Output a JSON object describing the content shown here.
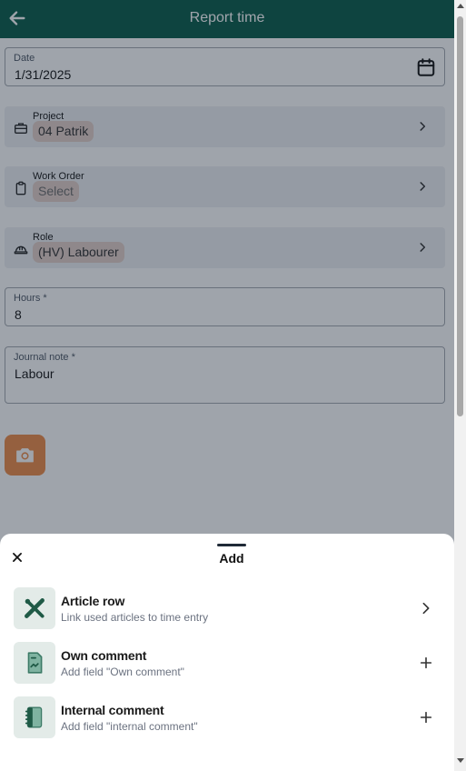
{
  "header": {
    "title": "Report time",
    "back_icon": "arrow-left-icon"
  },
  "form": {
    "date": {
      "label": "Date",
      "value": "1/31/2025",
      "icon": "calendar-icon"
    },
    "project": {
      "label": "Project",
      "value": "04 Patrik",
      "icon": "briefcase-icon"
    },
    "work_order": {
      "label": "Work Order",
      "value": "Select",
      "icon": "clipboard-icon"
    },
    "role": {
      "label": "Role",
      "value": "(HV) Labourer",
      "icon": "hard-hat-icon"
    },
    "hours": {
      "label": "Hours *",
      "value": "8"
    },
    "journal_note": {
      "label": "Journal note *",
      "value": "Labour"
    },
    "camera_icon": "camera-icon"
  },
  "sheet": {
    "title": "Add",
    "close_icon": "close-icon",
    "options": [
      {
        "title": "Article row",
        "subtitle": "Link used articles to time entry",
        "icon": "tools-icon",
        "action_icon": "chevron-right-icon"
      },
      {
        "title": "Own comment",
        "subtitle": "Add field \"Own comment\"",
        "icon": "document-icon",
        "action_icon": "plus-icon"
      },
      {
        "title": "Internal comment",
        "subtitle": "Add field \"internal comment\"",
        "icon": "notebook-icon",
        "action_icon": "plus-icon"
      }
    ]
  },
  "colors": {
    "header": "#065b47",
    "accent": "#ee8a45",
    "chip": "#e3cfc8"
  }
}
